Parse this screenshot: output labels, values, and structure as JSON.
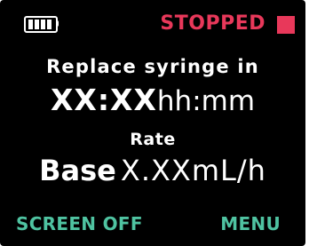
{
  "status": {
    "battery_icon": "battery-full-icon",
    "battery_level": 1.0,
    "label": "STOPPED",
    "stop_icon": "stop-square-icon",
    "color": "#e8385a"
  },
  "syringe": {
    "heading": "Replace syringe in",
    "time_value": "XX:XX",
    "time_unit": "hh:mm"
  },
  "rate": {
    "heading": "Rate",
    "label": "Base",
    "value": "X.XXmL/h"
  },
  "softkeys": {
    "left": "SCREEN OFF",
    "right": "MENU",
    "color": "#4fc3a1"
  }
}
